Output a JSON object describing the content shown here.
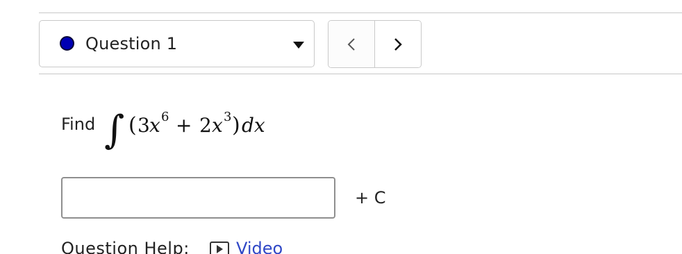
{
  "question_nav": {
    "selected_question": "Question 1",
    "status_color": "#0000b4",
    "prev_icon": "chevron-left-icon",
    "next_icon": "chevron-right-icon"
  },
  "problem": {
    "prompt": "Find",
    "integral": {
      "integral_sign": "∫",
      "open_paren": "(",
      "coef1": "3",
      "var1": "x",
      "exp1": "6",
      "plus": "+",
      "coef2": "2",
      "var2": "x",
      "exp2": "3",
      "close_paren": ")",
      "differential": "dx"
    }
  },
  "answer": {
    "value": "",
    "placeholder": "",
    "constant_label": "+ C"
  },
  "help": {
    "label": "Question Help:",
    "video_label": "Video",
    "video_icon": "play-video-icon",
    "link_color": "#2f47c6"
  }
}
